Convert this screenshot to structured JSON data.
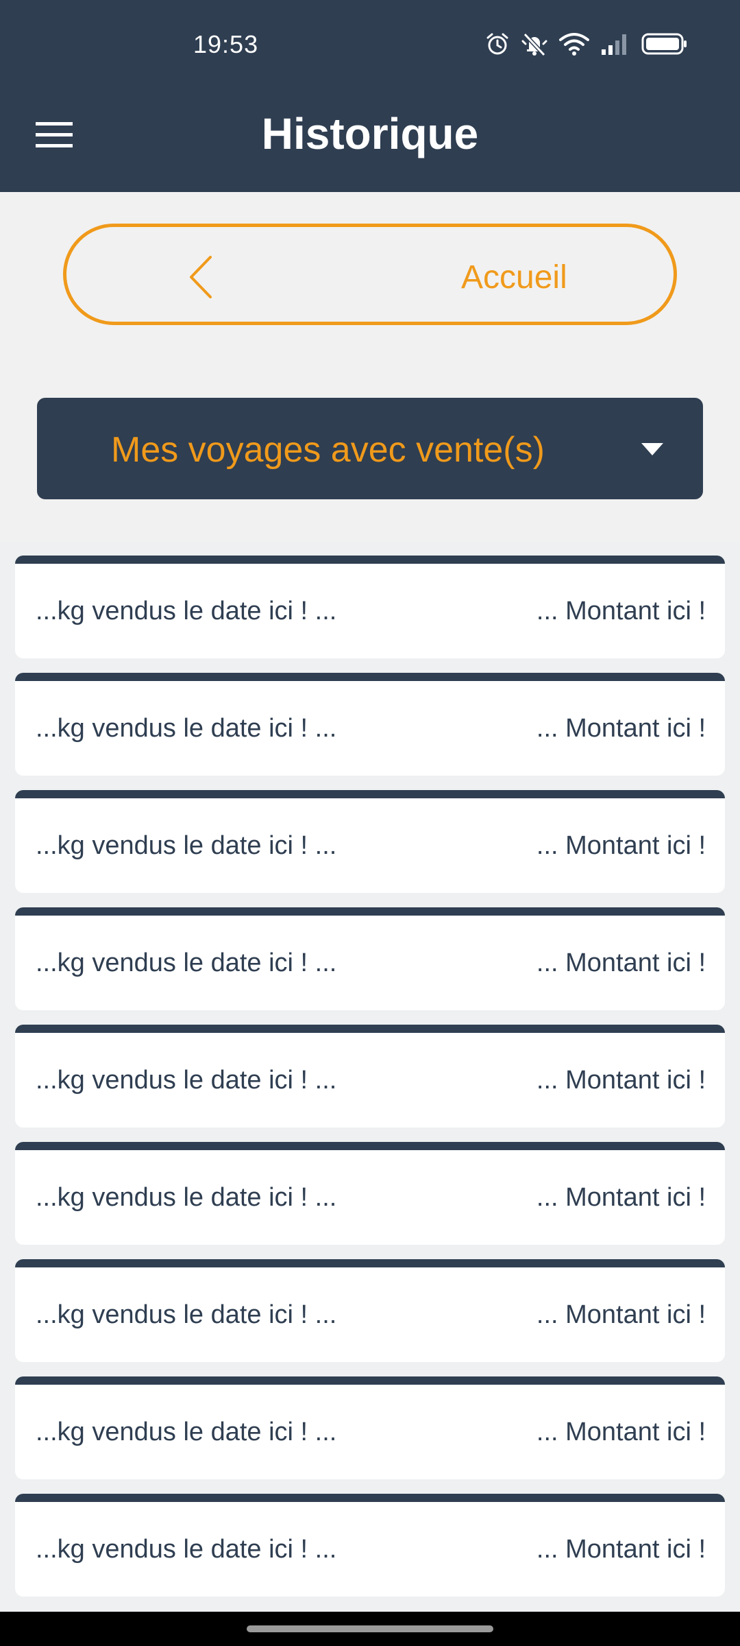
{
  "status_bar": {
    "time": "19:53",
    "icons": [
      "alarm-icon",
      "mute-icon",
      "wifi-icon",
      "signal-icon",
      "battery-icon"
    ]
  },
  "header": {
    "title": "Historique",
    "menu_icon": "hamburger-menu-icon"
  },
  "home_button": {
    "label": "Accueil",
    "icon": "chevron-left-icon"
  },
  "filter_dropdown": {
    "selected": "Mes voyages avec vente(s)",
    "icon": "caret-down-icon"
  },
  "history_items": [
    {
      "left_text": "...kg vendus le date ici ! ...",
      "right_text": "... Montant ici !"
    },
    {
      "left_text": "...kg vendus le date ici ! ...",
      "right_text": "... Montant ici !"
    },
    {
      "left_text": "...kg vendus le date ici ! ...",
      "right_text": "... Montant ici !"
    },
    {
      "left_text": "...kg vendus le date ici ! ...",
      "right_text": "... Montant ici !"
    },
    {
      "left_text": "...kg vendus le date ici ! ...",
      "right_text": "... Montant ici !"
    },
    {
      "left_text": "...kg vendus le date ici ! ...",
      "right_text": "... Montant ici !"
    },
    {
      "left_text": "...kg vendus le date ici ! ...",
      "right_text": "... Montant ici !"
    },
    {
      "left_text": "...kg vendus le date ici ! ...",
      "right_text": "... Montant ici !"
    },
    {
      "left_text": "...kg vendus le date ici ! ...",
      "right_text": "... Montant ici !"
    }
  ],
  "colors": {
    "primary": "#2f3e51",
    "accent": "#f09a1b",
    "background": "#eef0f1",
    "card": "#ffffff"
  }
}
